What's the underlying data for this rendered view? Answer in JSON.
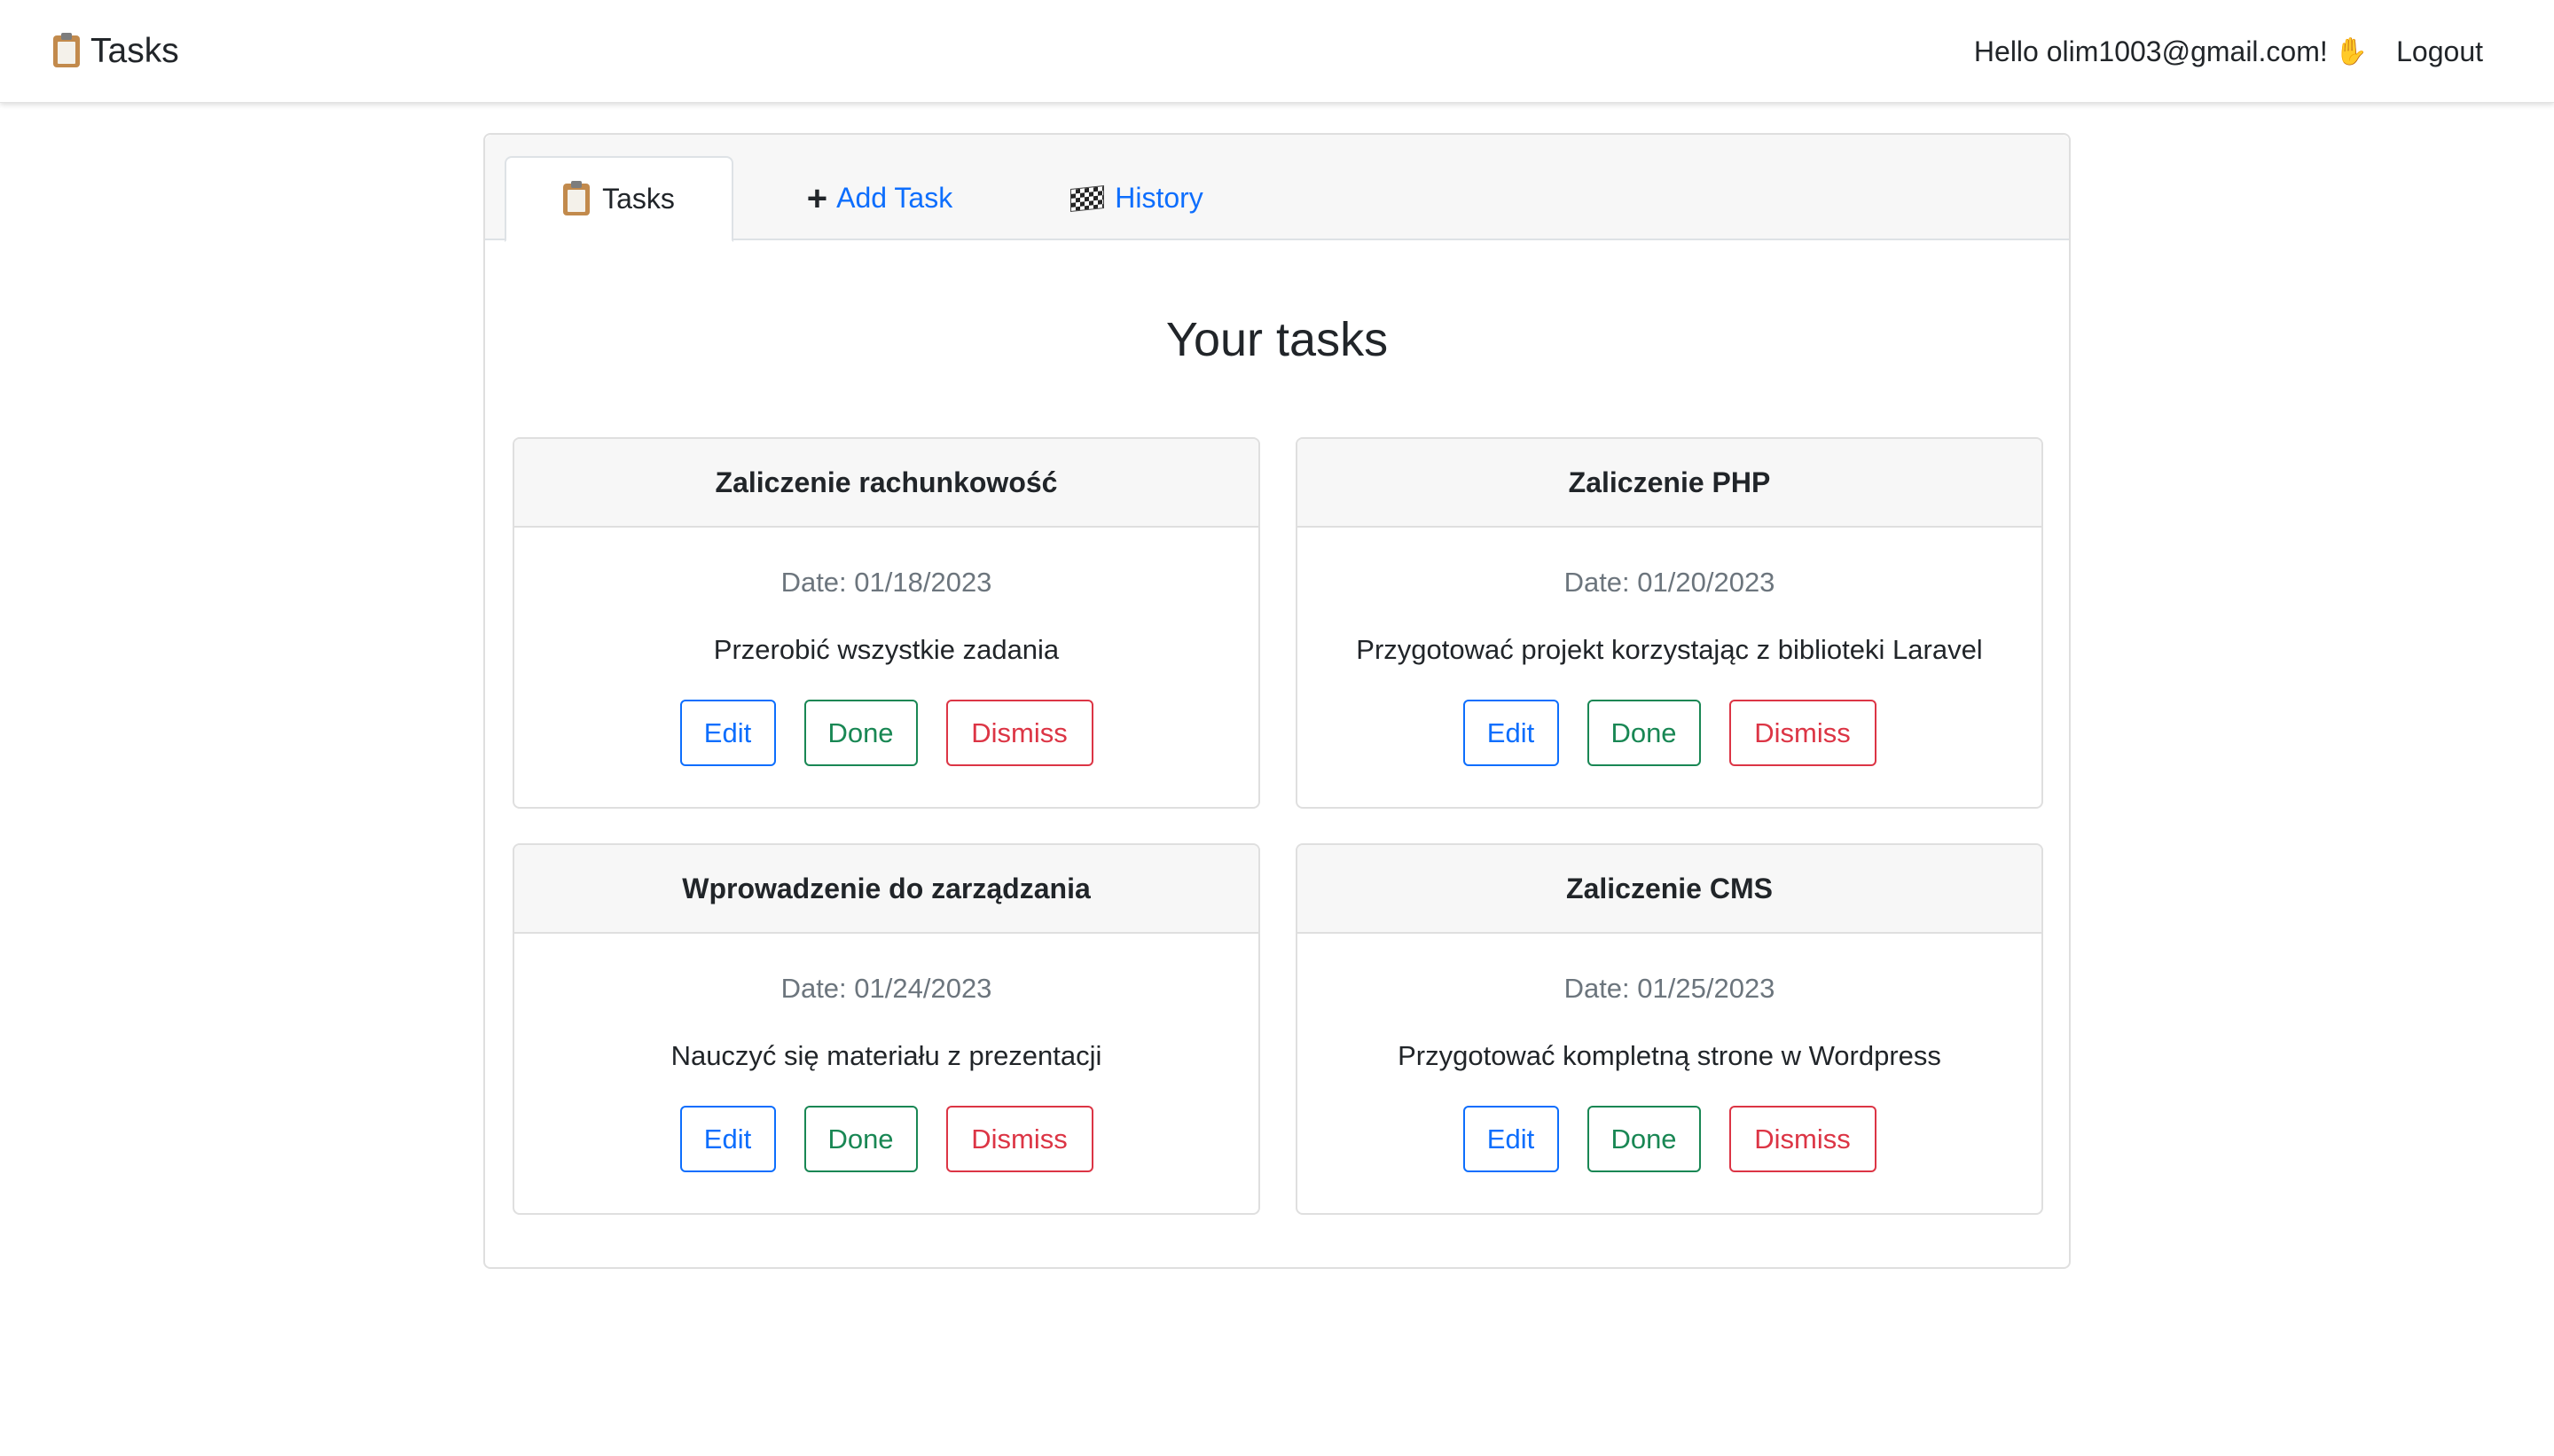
{
  "navbar": {
    "brand_label": "Tasks",
    "greeting": "Hello olim1003@gmail.com!",
    "logout_label": "Logout"
  },
  "tabs": [
    {
      "label": "Tasks",
      "active": true
    },
    {
      "label": "Add Task",
      "active": false
    },
    {
      "label": "History",
      "active": false
    }
  ],
  "page_title": "Your tasks",
  "tasks": [
    {
      "title": "Zaliczenie rachunkowość",
      "date": "Date: 01/18/2023",
      "description": "Przerobić wszystkie zadania"
    },
    {
      "title": "Zaliczenie PHP",
      "date": "Date: 01/20/2023",
      "description": "Przygotować projekt korzystając z biblioteki Laravel"
    },
    {
      "title": "Wprowadzenie do zarządzania",
      "date": "Date: 01/24/2023",
      "description": "Nauczyć się materiału z prezentacji"
    },
    {
      "title": "Zaliczenie CMS",
      "date": "Date: 01/25/2023",
      "description": "Przygotować kompletną strone w Wordpress"
    }
  ],
  "buttons": {
    "edit_label": "Edit",
    "done_label": "Done",
    "dismiss_label": "Dismiss"
  },
  "colors": {
    "primary": "#0d6efd",
    "success": "#198754",
    "danger": "#dc3545",
    "muted": "#6c757d"
  },
  "icons": {
    "brand": "clipboard-icon",
    "greeting": "waving-hand-icon",
    "tab_tasks": "clipboard-icon",
    "tab_add": "plus-icon",
    "tab_history": "checkered-flag-icon"
  }
}
